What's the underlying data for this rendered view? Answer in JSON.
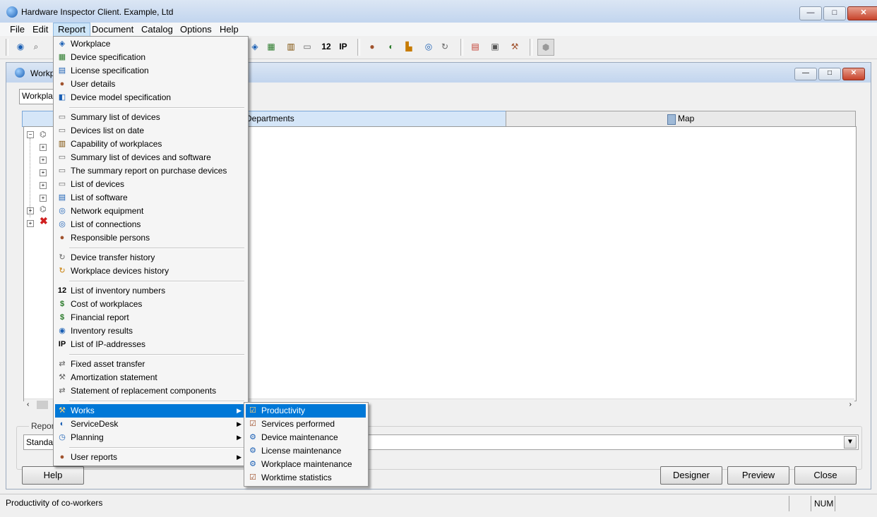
{
  "window": {
    "title": "Hardware Inspector Client. Example, Ltd",
    "min": "—",
    "max": "□",
    "close": "✕"
  },
  "menubar": [
    "File",
    "Edit",
    "Report",
    "Document",
    "Catalog",
    "Options",
    "Help"
  ],
  "child": {
    "title": "Workp",
    "workplace_field": "Workpla"
  },
  "tabs": {
    "departments": "Departments",
    "map": "Map"
  },
  "report_group": {
    "label": "Repor",
    "combo_value": "Standa"
  },
  "buttons": {
    "help": "Help",
    "designer": "Designer",
    "preview": "Preview",
    "close": "Close"
  },
  "status": {
    "text": "Productivity of co-workers",
    "num": "NUM"
  },
  "toolbar_text": {
    "num12": "12",
    "ip": "IP"
  },
  "report_menu": {
    "group1": [
      "Workplace",
      "Device specification",
      "License specification",
      "User details",
      "Device model specification"
    ],
    "group2": [
      "Summary list of devices",
      "Devices list on date",
      "Capability of workplaces",
      "Summary list of devices and software",
      "The summary report on purchase devices",
      "List of devices",
      "List of software",
      "Network equipment",
      "List of connections",
      "Responsible persons"
    ],
    "group3": [
      "Device transfer history",
      "Workplace devices history"
    ],
    "group4": [
      "List of inventory numbers",
      "Cost of workplaces",
      "Financial report",
      "Inventory results",
      "List of IP-addresses"
    ],
    "group5": [
      "Fixed asset transfer",
      "Amortization statement",
      "Statement of replacement components"
    ],
    "group6": [
      "Works",
      "ServiceDesk",
      "Planning"
    ],
    "group7": [
      "User reports"
    ]
  },
  "works_submenu": [
    "Productivity",
    "Services performed",
    "Device maintenance",
    "License maintenance",
    "Workplace maintenance",
    "Worktime statistics"
  ],
  "colors": {
    "highlight": "#0078d7",
    "tab_active": "#d5e6f8"
  }
}
